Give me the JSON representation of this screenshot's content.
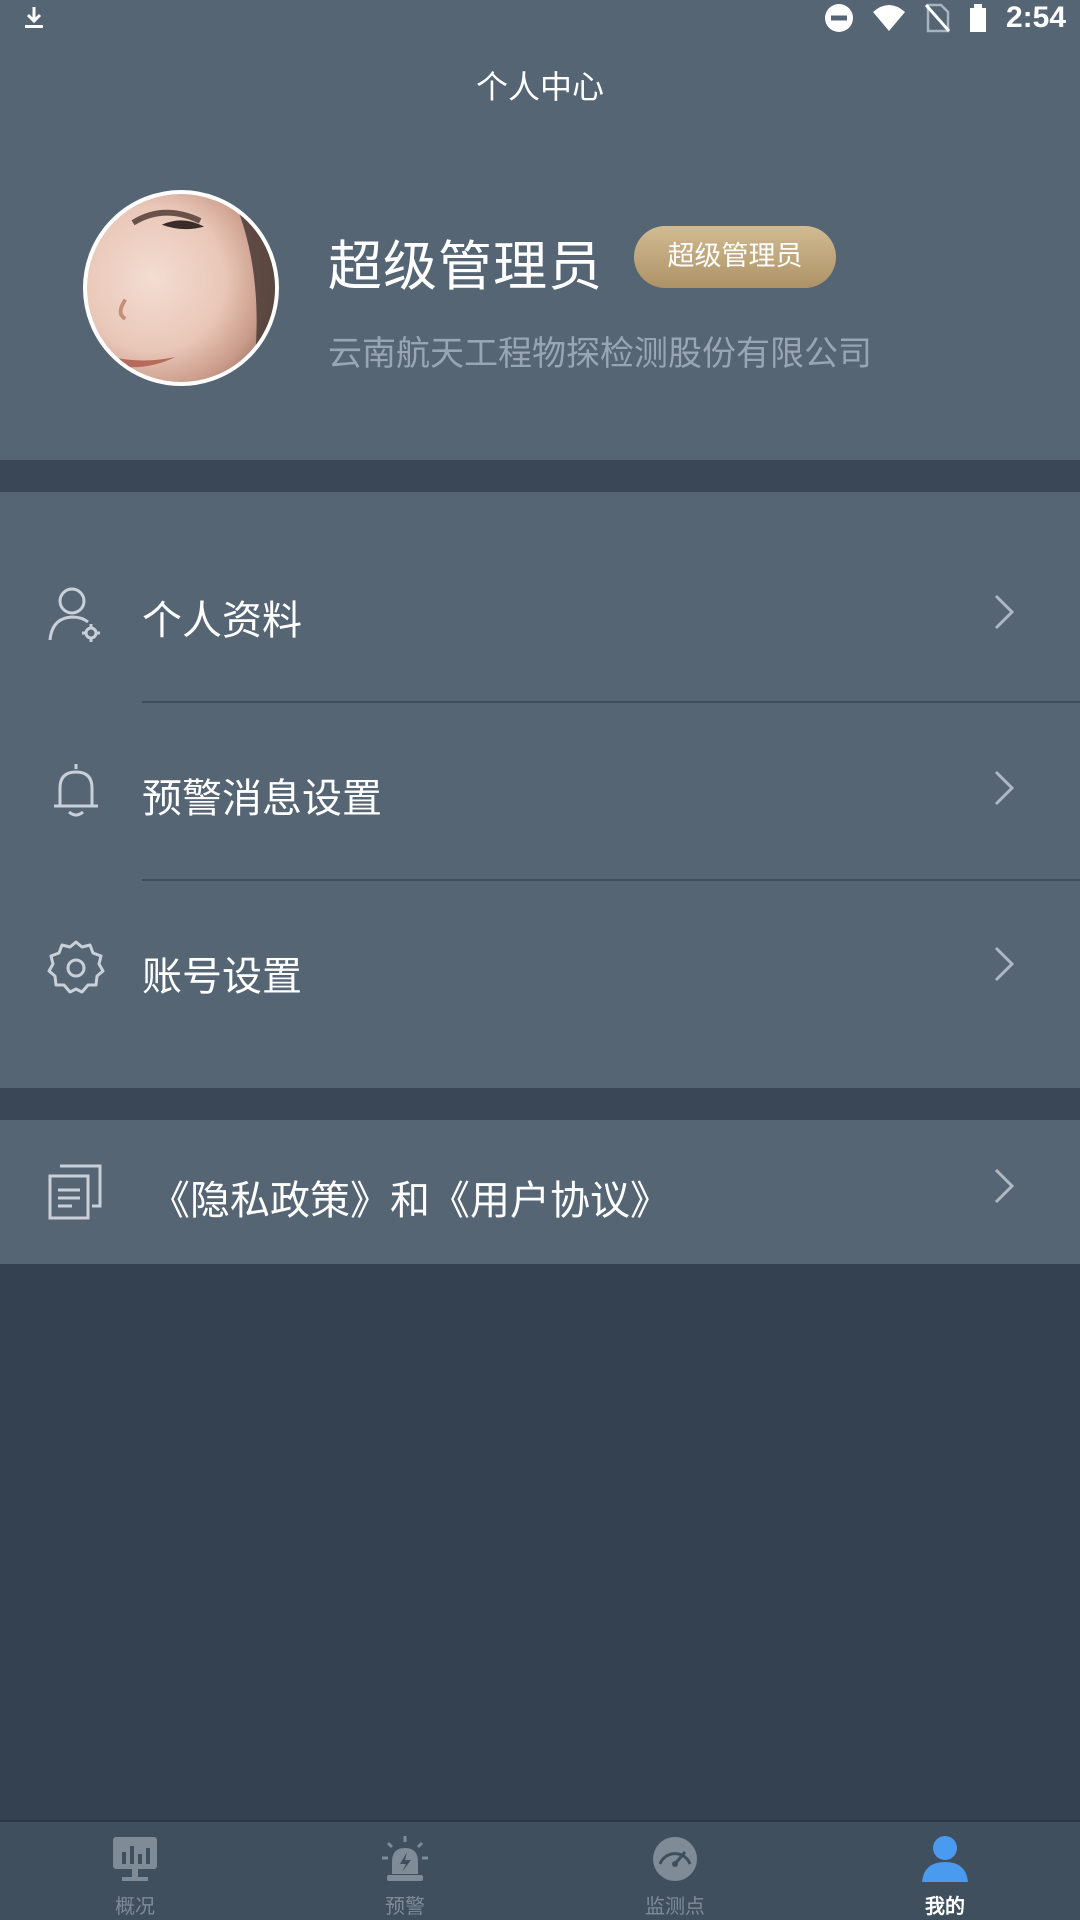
{
  "status_bar": {
    "time": "2:54",
    "icons": [
      "download-icon",
      "do-not-disturb-icon",
      "wifi-icon",
      "no-sim-icon",
      "battery-icon"
    ]
  },
  "header": {
    "title": "个人中心"
  },
  "profile": {
    "name": "超级管理员",
    "role_badge": "超级管理员",
    "company": "云南航天工程物探检测股份有限公司"
  },
  "menu": {
    "items": [
      {
        "label": "个人资料",
        "icon": "user-settings-icon"
      },
      {
        "label": "预警消息设置",
        "icon": "bell-icon"
      },
      {
        "label": "账号设置",
        "icon": "gear-icon"
      }
    ],
    "policy": {
      "label": "《隐私政策》和《用户协议》",
      "icon": "document-icon"
    }
  },
  "bottom_nav": {
    "items": [
      {
        "label": "概况",
        "icon": "dashboard-icon",
        "active": false
      },
      {
        "label": "预警",
        "icon": "alarm-icon",
        "active": false
      },
      {
        "label": "监测点",
        "icon": "gauge-icon",
        "active": false
      },
      {
        "label": "我的",
        "icon": "person-icon",
        "active": true
      }
    ]
  },
  "colors": {
    "background": "#344150",
    "panel": "#556574",
    "separator": "#3a4756",
    "badge_gold": "#c2a97f",
    "company_text": "#98a6b3",
    "nav_active": "#4a9bf0",
    "nav_inactive": "#7f8b97"
  }
}
